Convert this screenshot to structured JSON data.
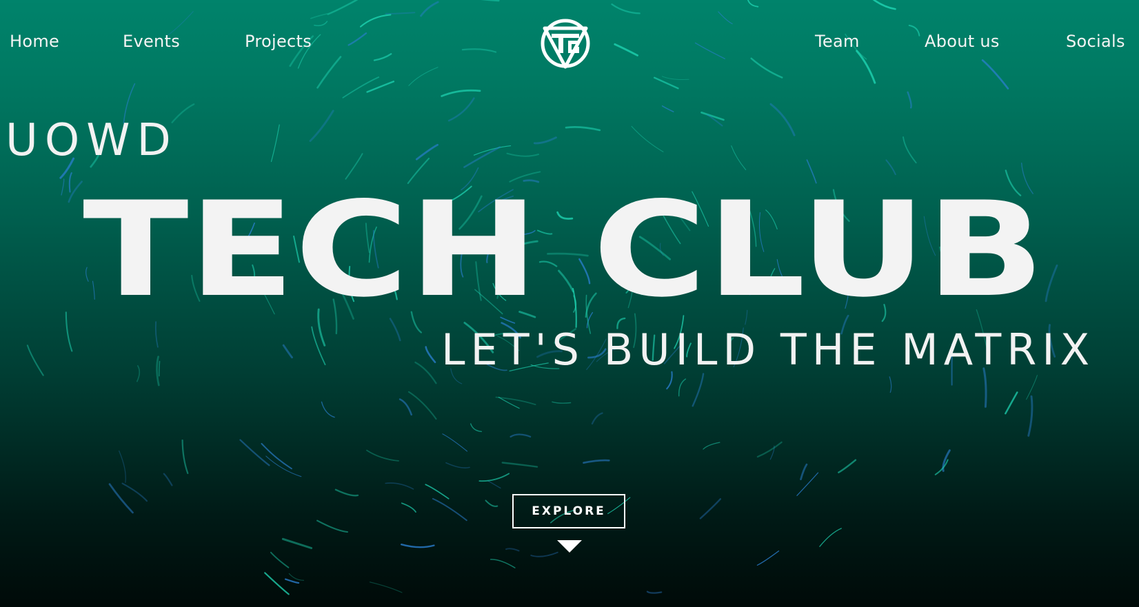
{
  "nav": {
    "left": [
      {
        "label": "Home"
      },
      {
        "label": "Events"
      },
      {
        "label": "Projects"
      }
    ],
    "right": [
      {
        "label": "Team"
      },
      {
        "label": "About us"
      },
      {
        "label": "Socials"
      }
    ]
  },
  "logo": {
    "icon": "tech-club-logo-icon",
    "letters": "TC"
  },
  "hero": {
    "prefix": "UOWD",
    "title": "TECH CLUB",
    "tagline": "LET'S BUILD THE MATRIX",
    "cta_label": "EXPLORE",
    "cta_icon": "triangle-down-icon"
  },
  "colors": {
    "background_top": "#00836b",
    "background_bottom": "#000a08",
    "streak_teal": "#1fd6b4",
    "streak_blue": "#2a7fd0",
    "text": "#f3f3f3"
  }
}
